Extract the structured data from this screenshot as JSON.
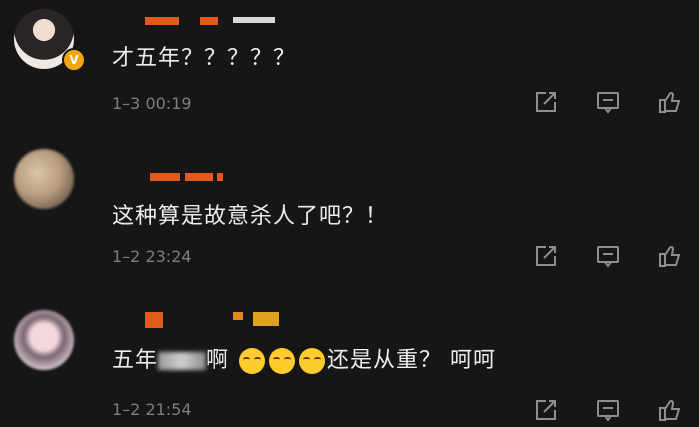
{
  "comments": [
    {
      "text": "才五年？？？？？",
      "time": "1–3 00:19",
      "verified_badge": "V"
    },
    {
      "text": "这种算是故意杀人了吧？！",
      "time": "1–2 23:24"
    },
    {
      "text_before": "五年",
      "text_mid": "啊",
      "emoji_names": [
        "grin-emoji",
        "grin-emoji",
        "grin-emoji"
      ],
      "text_after": "还是从重？ 呵呵",
      "time": "1–2 21:54"
    }
  ],
  "actions": [
    "share-icon",
    "comment-icon",
    "like-icon"
  ]
}
